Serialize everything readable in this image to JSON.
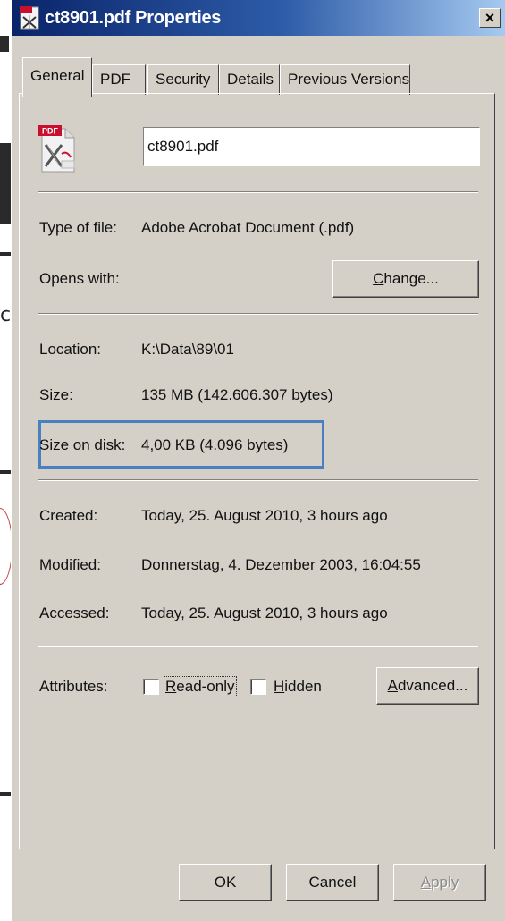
{
  "window": {
    "title": "ct8901.pdf Properties",
    "close_label": "×"
  },
  "tabs": [
    {
      "label": "General",
      "active": true
    },
    {
      "label": "PDF",
      "active": false
    },
    {
      "label": "Security",
      "active": false
    },
    {
      "label": "Details",
      "active": false
    },
    {
      "label": "Previous Versions",
      "active": false
    }
  ],
  "file": {
    "name": "ct8901.pdf",
    "icon": "pdf-file-icon",
    "icon_badge": "PDF"
  },
  "type_section": {
    "type_label": "Type of file:",
    "type_value": "Adobe Acrobat Document (.pdf)",
    "opens_label": "Opens with:",
    "change_button": "Change..."
  },
  "location_section": {
    "location_label": "Location:",
    "location_value": "K:\\Data\\89\\01",
    "size_label": "Size:",
    "size_value": "135 MB (142.606.307 bytes)",
    "size_on_disk_label": "Size on disk:",
    "size_on_disk_value": "4,00 KB (4.096 bytes)"
  },
  "dates_section": {
    "created_label": "Created:",
    "created_value": "Today, 25. August 2010, 3 hours ago",
    "modified_label": "Modified:",
    "modified_value": "Donnerstag, 4. Dezember 2003, 16:04:55",
    "accessed_label": "Accessed:",
    "accessed_value": "Today, 25. August 2010, 3 hours ago"
  },
  "attributes": {
    "label": "Attributes:",
    "readonly_label": "Read-only",
    "readonly_checked": false,
    "hidden_label": "Hidden",
    "hidden_checked": false,
    "advanced_button": "Advanced..."
  },
  "footer": {
    "ok": "OK",
    "cancel": "Cancel",
    "apply": "Apply"
  },
  "colors": {
    "dialog_face": "#d4d0c8",
    "titlebar_start": "#0a246a",
    "titlebar_end": "#a6caf0",
    "highlight_border": "#4a7fc0",
    "pdf_red": "#c8102e"
  },
  "background": {
    "stray_char": "c"
  }
}
